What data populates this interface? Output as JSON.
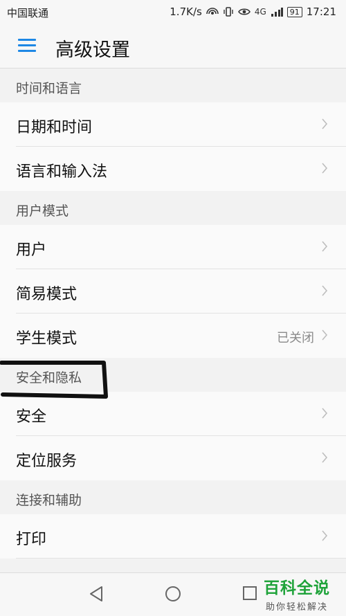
{
  "status_bar": {
    "carrier": "中国联通",
    "speed": "1.7K/s",
    "network": "4G",
    "battery": "91",
    "time": "17:21"
  },
  "header": {
    "title": "高级设置",
    "menu_icon": "hamburger-menu-icon",
    "accent_color": "#1e88e5"
  },
  "sections": [
    {
      "title": "时间和语言",
      "items": [
        {
          "label": "日期和时间",
          "value": ""
        },
        {
          "label": "语言和输入法",
          "value": ""
        }
      ]
    },
    {
      "title": "用户模式",
      "items": [
        {
          "label": "用户",
          "value": ""
        },
        {
          "label": "简易模式",
          "value": ""
        },
        {
          "label": "学生模式",
          "value": "已关闭"
        }
      ]
    },
    {
      "title": "安全和隐私",
      "items": [
        {
          "label": "安全",
          "value": ""
        },
        {
          "label": "定位服务",
          "value": ""
        }
      ]
    },
    {
      "title": "连接和辅助",
      "items": [
        {
          "label": "打印",
          "value": ""
        }
      ]
    }
  ],
  "nav_bar": {
    "back": "back-triangle-icon",
    "home": "home-circle-icon",
    "recents": "recents-square-icon"
  },
  "watermark": {
    "main": "百科全说",
    "sub": "助你轻松解决"
  }
}
